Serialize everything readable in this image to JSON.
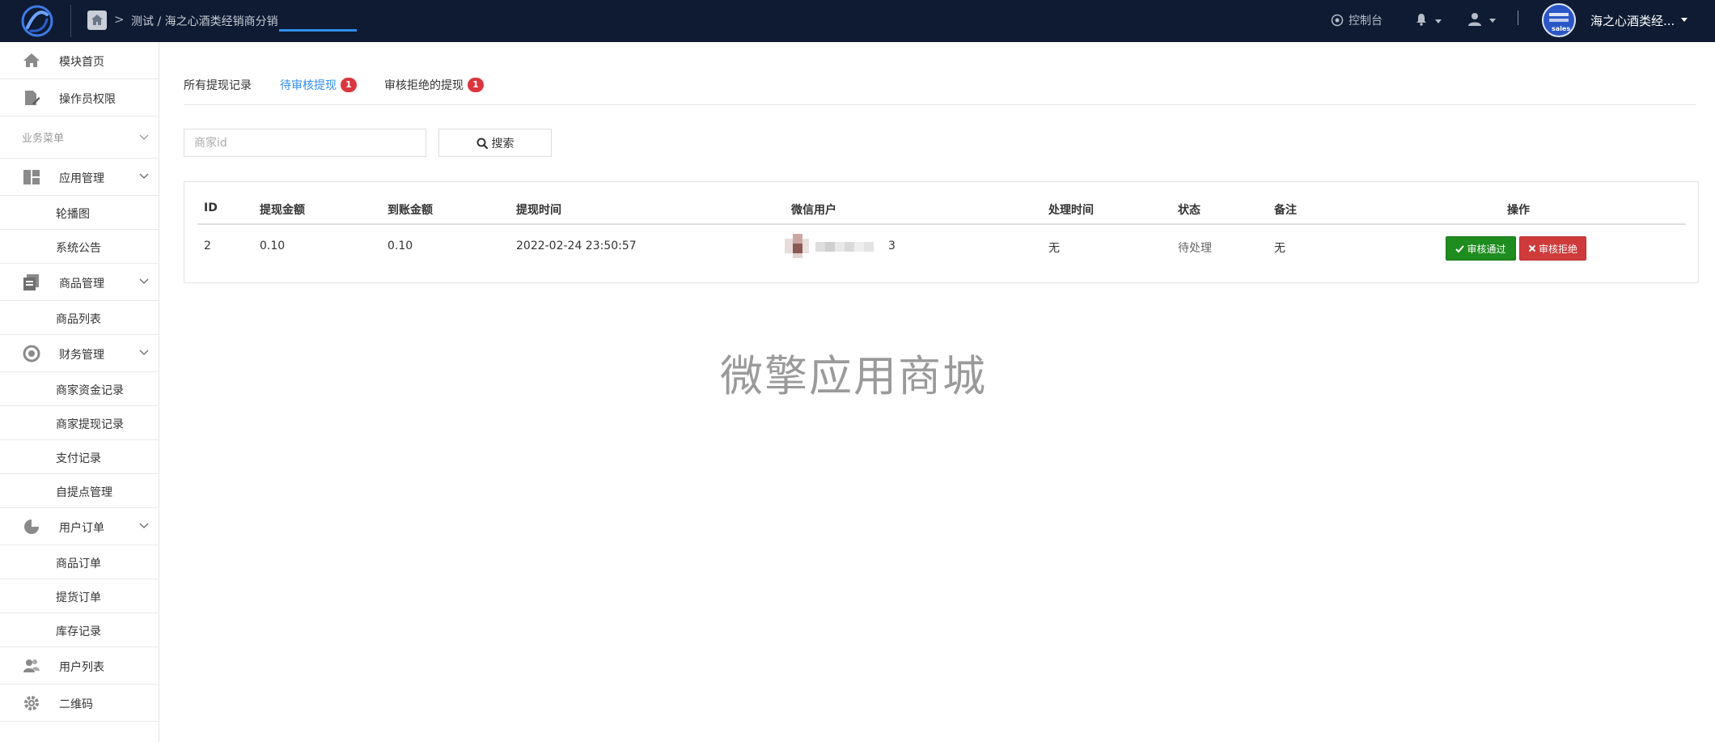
{
  "header": {
    "breadcrumb_sep": ">",
    "breadcrumb": "测试 / 海之心酒类经销商分销",
    "console_label": "控制台",
    "user_name": "海之心酒类经...",
    "avatar_text": "sales"
  },
  "sidebar": {
    "items": [
      {
        "label": "模块首页",
        "icon": "home-icon"
      },
      {
        "label": "操作员权限",
        "icon": "edit-doc-icon"
      },
      {
        "label": "业务菜单"
      },
      {
        "label": "应用管理",
        "icon": "dashboard-icon"
      },
      {
        "label": "轮播图"
      },
      {
        "label": "系统公告"
      },
      {
        "label": "商品管理",
        "icon": "copy-icon"
      },
      {
        "label": "商品列表"
      },
      {
        "label": "财务管理",
        "icon": "refresh-money-icon"
      },
      {
        "label": "商家资金记录"
      },
      {
        "label": "商家提现记录"
      },
      {
        "label": "支付记录"
      },
      {
        "label": "自提点管理"
      },
      {
        "label": "用户订单",
        "icon": "pie-chart-icon"
      },
      {
        "label": "商品订单"
      },
      {
        "label": "提货订单"
      },
      {
        "label": "库存记录"
      },
      {
        "label": "用户列表",
        "icon": "users-icon"
      },
      {
        "label": "二维码",
        "icon": "gear-icon"
      }
    ]
  },
  "tabs": [
    {
      "label": "所有提现记录"
    },
    {
      "label": "待审核提现",
      "badge": "1"
    },
    {
      "label": "审核拒绝的提现",
      "badge": "1"
    }
  ],
  "search": {
    "placeholder": "商家id",
    "button_label": "搜索"
  },
  "table": {
    "headers": [
      "ID",
      "提现金额",
      "到账金额",
      "提现时间",
      "微信用户",
      "处理时间",
      "状态",
      "备注",
      "操作"
    ],
    "rows": [
      {
        "id": "2",
        "amount": "0.10",
        "received": "0.10",
        "time": "2022-02-24 23:50:57",
        "wechat_user_suffix": "3",
        "process_time": "无",
        "status": "待处理",
        "remark": "无",
        "approve_label": "审核通过",
        "reject_label": "审核拒绝"
      }
    ]
  },
  "watermark": "微擎应用商城",
  "colors": {
    "topbar": "#0e1b33",
    "accent": "#2f8ded",
    "badge": "#d9363e",
    "approve": "#1e8c1e",
    "reject": "#cf3b3b"
  }
}
